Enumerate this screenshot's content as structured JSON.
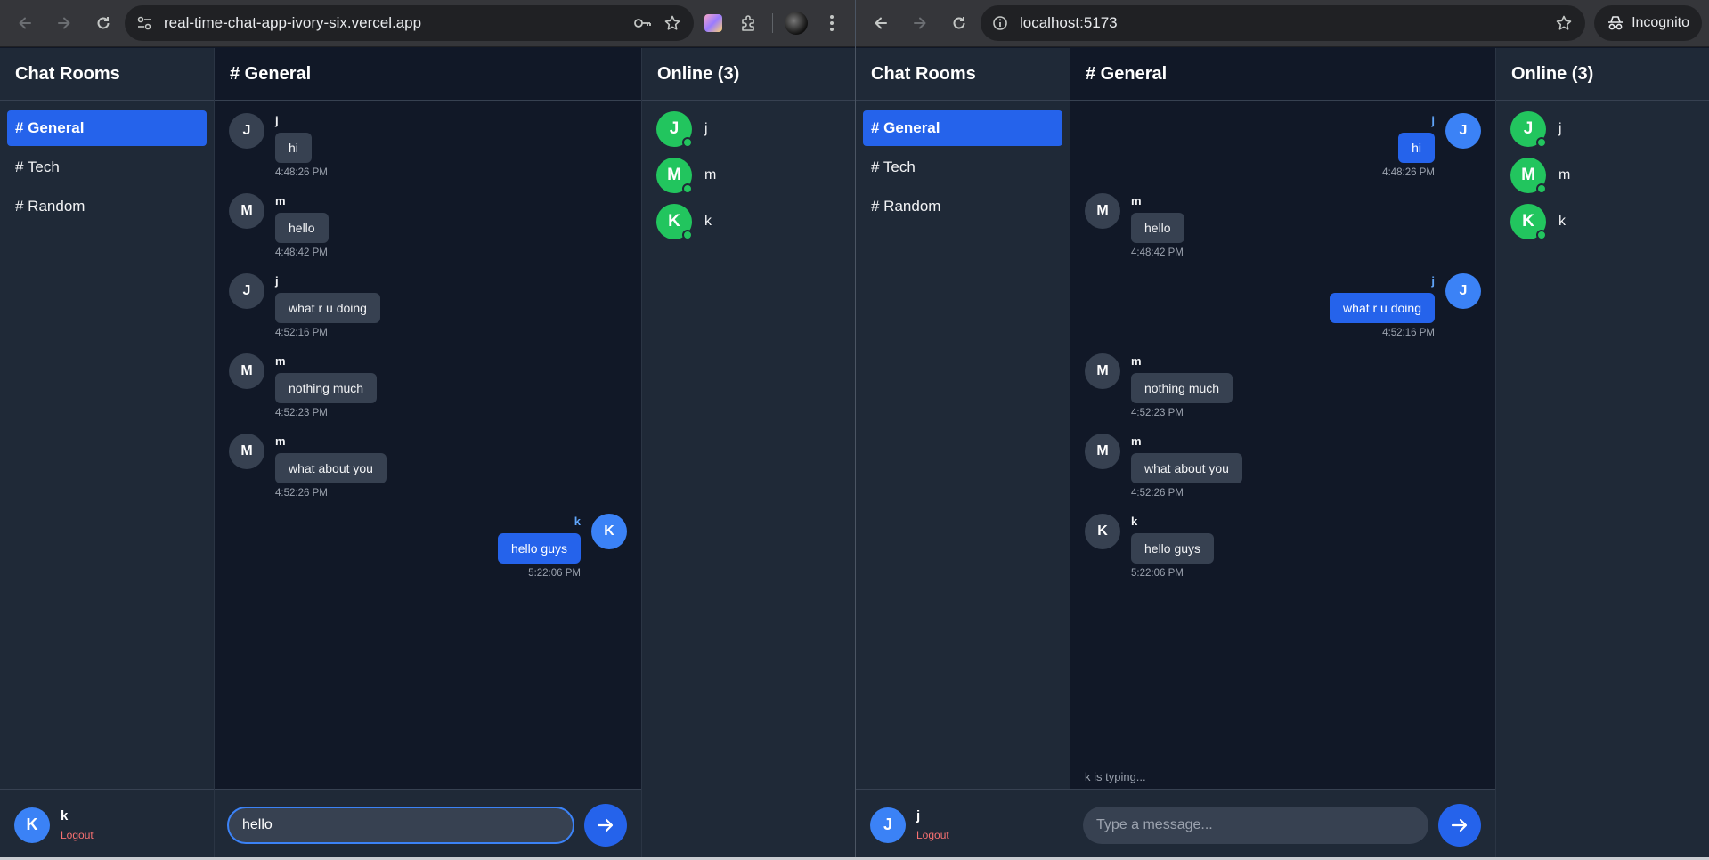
{
  "windows": [
    {
      "id": "left",
      "url": "real-time-chat-app-ivory-six.vercel.app",
      "incognito": false,
      "rooms_title": "Chat Rooms",
      "rooms": [
        "# General",
        "# Tech",
        "# Random"
      ],
      "active_room": 0,
      "chat_title": "# General",
      "messages": [
        {
          "avatar": "J",
          "user": "j",
          "text": "hi",
          "time": "4:48:26 PM",
          "own": false
        },
        {
          "avatar": "M",
          "user": "m",
          "text": "hello",
          "time": "4:48:42 PM",
          "own": false
        },
        {
          "avatar": "J",
          "user": "j",
          "text": "what r u doing",
          "time": "4:52:16 PM",
          "own": false
        },
        {
          "avatar": "M",
          "user": "m",
          "text": "nothing much",
          "time": "4:52:23 PM",
          "own": false
        },
        {
          "avatar": "M",
          "user": "m",
          "text": "what about you",
          "time": "4:52:26 PM",
          "own": false
        },
        {
          "avatar": "K",
          "user": "k",
          "text": "hello guys",
          "time": "5:22:06 PM",
          "own": true
        }
      ],
      "typing": "",
      "input_value": "hello",
      "input_placeholder": "Type a message...",
      "input_focused": true,
      "online_title": "Online (3)",
      "online_users": [
        {
          "avatar": "J",
          "name": "j"
        },
        {
          "avatar": "M",
          "name": "m"
        },
        {
          "avatar": "K",
          "name": "k"
        }
      ],
      "me": {
        "avatar": "K",
        "name": "k",
        "logout": "Logout"
      }
    },
    {
      "id": "right",
      "url": "localhost:5173",
      "incognito": true,
      "incognito_label": "Incognito",
      "rooms_title": "Chat Rooms",
      "rooms": [
        "# General",
        "# Tech",
        "# Random"
      ],
      "active_room": 0,
      "chat_title": "# General",
      "messages": [
        {
          "avatar": "J",
          "user": "j",
          "text": "hi",
          "time": "4:48:26 PM",
          "own": true
        },
        {
          "avatar": "M",
          "user": "m",
          "text": "hello",
          "time": "4:48:42 PM",
          "own": false
        },
        {
          "avatar": "J",
          "user": "j",
          "text": "what r u doing",
          "time": "4:52:16 PM",
          "own": true
        },
        {
          "avatar": "M",
          "user": "m",
          "text": "nothing much",
          "time": "4:52:23 PM",
          "own": false
        },
        {
          "avatar": "M",
          "user": "m",
          "text": "what about you",
          "time": "4:52:26 PM",
          "own": false
        },
        {
          "avatar": "K",
          "user": "k",
          "text": "hello guys",
          "time": "5:22:06 PM",
          "own": false
        }
      ],
      "typing": "k is typing...",
      "input_value": "",
      "input_placeholder": "Type a message...",
      "input_focused": false,
      "online_title": "Online (3)",
      "online_users": [
        {
          "avatar": "J",
          "name": "j"
        },
        {
          "avatar": "M",
          "name": "m"
        },
        {
          "avatar": "K",
          "name": "k"
        }
      ],
      "me": {
        "avatar": "J",
        "name": "j",
        "logout": "Logout"
      }
    }
  ],
  "colors": {
    "accent": "#2563eb",
    "own_avatar": "#3b82f6",
    "online_green": "#22c55e",
    "logout_red": "#f87171",
    "panel_bg": "#1f2937",
    "chat_bg": "#111827"
  },
  "icons": {
    "back": "arrow-left-icon",
    "forward": "arrow-right-icon",
    "reload": "reload-icon",
    "site_info": "tune-icon",
    "key": "key-icon",
    "star": "star-icon",
    "extension": "puzzle-icon",
    "menu": "kebab-menu-icon",
    "incognito": "incognito-icon",
    "info": "info-icon",
    "send": "send-arrow-icon"
  }
}
